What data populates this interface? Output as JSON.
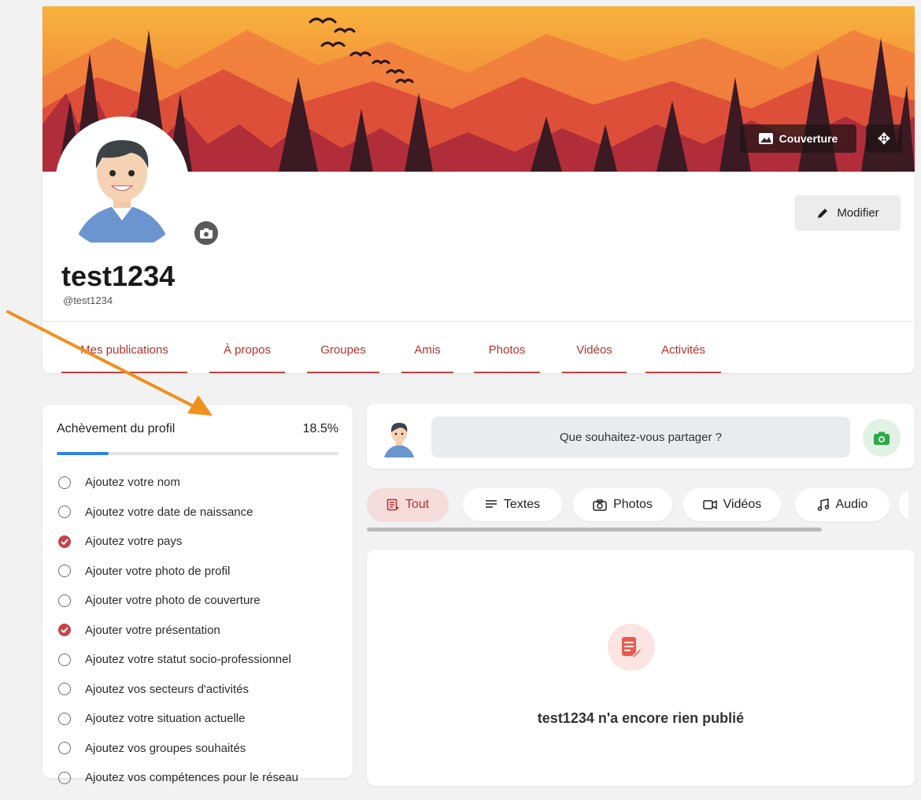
{
  "cover": {
    "cover_button_label": "Couverture",
    "move_icon": "move-arrows-icon"
  },
  "profile": {
    "username": "test1234",
    "handle": "@test1234",
    "edit_label": "Modifier"
  },
  "tabs": [
    {
      "label": "Mes publications"
    },
    {
      "label": "À propos"
    },
    {
      "label": "Groupes"
    },
    {
      "label": "Amis"
    },
    {
      "label": "Photos"
    },
    {
      "label": "Vidéos"
    },
    {
      "label": "Activités"
    }
  ],
  "completion": {
    "title": "Achèvement du profil",
    "percent_label": "18.5%",
    "percent_value": 18.5,
    "items": [
      {
        "label": "Ajoutez votre nom",
        "done": false
      },
      {
        "label": "Ajoutez votre date de naissance",
        "done": false
      },
      {
        "label": "Ajoutez votre pays",
        "done": true
      },
      {
        "label": "Ajouter votre photo de profil",
        "done": false
      },
      {
        "label": "Ajouter votre photo de couverture",
        "done": false
      },
      {
        "label": "Ajouter votre présentation",
        "done": true
      },
      {
        "label": "Ajoutez votre statut socio-professionnel",
        "done": false
      },
      {
        "label": "Ajoutez vos secteurs d'activités",
        "done": false
      },
      {
        "label": "Ajoutez votre situation actuelle",
        "done": false
      },
      {
        "label": "Ajoutez vos groupes souhaités",
        "done": false
      },
      {
        "label": "Ajoutez vos compétences pour le réseau",
        "done": false
      }
    ]
  },
  "composer": {
    "placeholder": "Que souhaitez-vous partager ?"
  },
  "filters": [
    {
      "label": "Tout",
      "icon": "document-list-icon",
      "active": true
    },
    {
      "label": "Textes",
      "icon": "text-lines-icon",
      "active": false
    },
    {
      "label": "Photos",
      "icon": "camera-icon",
      "active": false
    },
    {
      "label": "Vidéos",
      "icon": "video-camera-icon",
      "active": false
    },
    {
      "label": "Audio",
      "icon": "music-note-icon",
      "active": false
    }
  ],
  "feed": {
    "empty_message": "test1234 n'a encore rien publié"
  },
  "colors": {
    "accent": "#b3332f",
    "progress": "#2e84e6",
    "done_check": "#c4444a",
    "annotation_arrow": "#f0901d"
  }
}
